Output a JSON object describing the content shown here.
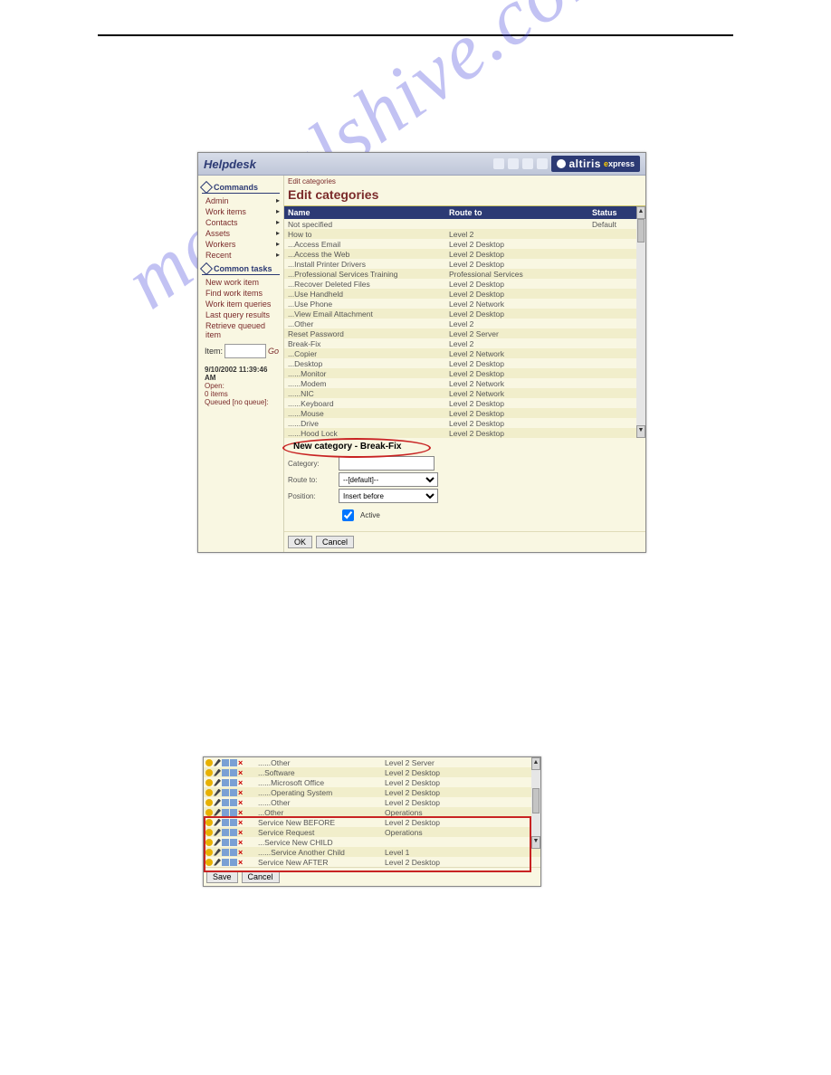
{
  "watermark": "manualshive.com",
  "screenshot1": {
    "app_title": "Helpdesk",
    "brand_altiris": "altiris",
    "brand_express_prefix": "e",
    "brand_express_rest": "xpress",
    "sidebar": {
      "commands_header": "Commands",
      "tasks_header": "Common tasks",
      "commands": [
        {
          "label": "Admin",
          "has_sub": true
        },
        {
          "label": "Work items",
          "has_sub": true
        },
        {
          "label": "Contacts",
          "has_sub": true
        },
        {
          "label": "Assets",
          "has_sub": true
        },
        {
          "label": "Workers",
          "has_sub": true
        },
        {
          "label": "Recent",
          "has_sub": true
        }
      ],
      "tasks": [
        {
          "label": "New work item"
        },
        {
          "label": "Find work items"
        },
        {
          "label": "Work item queries"
        },
        {
          "label": "Last query results"
        },
        {
          "label": "Retrieve queued item"
        }
      ],
      "item_label": "Item:",
      "go_label": "Go",
      "timestamp": "9/10/2002 11:39:46 AM",
      "status_open": "Open:",
      "status_items": "0 items",
      "status_queued": "Queued [no queue]:"
    },
    "breadcrumb": "Edit categories",
    "heading": "Edit categories",
    "columns": {
      "name": "Name",
      "route": "Route to",
      "status": "Status"
    },
    "rows": [
      {
        "name": "Not specified",
        "route": "",
        "status": "Default"
      },
      {
        "name": "How to",
        "route": "Level 2",
        "status": ""
      },
      {
        "name": "...Access Email",
        "route": "Level 2 Desktop",
        "status": ""
      },
      {
        "name": "...Access the Web",
        "route": "Level 2 Desktop",
        "status": ""
      },
      {
        "name": "...Install Printer Drivers",
        "route": "Level 2 Desktop",
        "status": ""
      },
      {
        "name": "...Professional Services Training",
        "route": "Professional Services",
        "status": ""
      },
      {
        "name": "...Recover Deleted Files",
        "route": "Level 2 Desktop",
        "status": ""
      },
      {
        "name": "...Use Handheld",
        "route": "Level 2 Desktop",
        "status": ""
      },
      {
        "name": "...Use Phone",
        "route": "Level 2 Network",
        "status": ""
      },
      {
        "name": "...View Email Attachment",
        "route": "Level 2 Desktop",
        "status": ""
      },
      {
        "name": "...Other",
        "route": "Level 2",
        "status": ""
      },
      {
        "name": "Reset Password",
        "route": "Level 2 Server",
        "status": ""
      },
      {
        "name": "Break-Fix",
        "route": "Level 2",
        "status": ""
      },
      {
        "name": "...Copier",
        "route": "Level 2 Network",
        "status": ""
      },
      {
        "name": "...Desktop",
        "route": "Level 2 Desktop",
        "status": ""
      },
      {
        "name": "......Monitor",
        "route": "Level 2 Desktop",
        "status": ""
      },
      {
        "name": "......Modem",
        "route": "Level 2 Network",
        "status": ""
      },
      {
        "name": "......NIC",
        "route": "Level 2 Network",
        "status": ""
      },
      {
        "name": "......Keyboard",
        "route": "Level 2 Desktop",
        "status": ""
      },
      {
        "name": "......Mouse",
        "route": "Level 2 Desktop",
        "status": ""
      },
      {
        "name": "......Drive",
        "route": "Level 2 Desktop",
        "status": ""
      },
      {
        "name": "......Hood Lock",
        "route": "Level 2 Desktop",
        "status": ""
      }
    ],
    "form": {
      "title": "New category - Break-Fix",
      "category_label": "Category:",
      "route_label": "Route to:",
      "route_value": "--[default]--",
      "position_label": "Position:",
      "position_value": "Insert before",
      "active_label": "Active",
      "ok": "OK",
      "cancel": "Cancel"
    }
  },
  "screenshot2": {
    "rows": [
      {
        "name": "......Other",
        "route": "Level 2 Server"
      },
      {
        "name": "...Software",
        "route": "Level 2 Desktop"
      },
      {
        "name": "......Microsoft Office",
        "route": "Level 2 Desktop"
      },
      {
        "name": "......Operating System",
        "route": "Level 2 Desktop"
      },
      {
        "name": "......Other",
        "route": "Level 2 Desktop"
      },
      {
        "name": "...Other",
        "route": "Operations"
      },
      {
        "name": "Service New BEFORE",
        "route": "Level 2 Desktop"
      },
      {
        "name": "Service Request",
        "route": "Operations"
      },
      {
        "name": "...Service New CHILD",
        "route": ""
      },
      {
        "name": "......Service Another Child",
        "route": "Level 1"
      },
      {
        "name": "Service New AFTER",
        "route": "Level 2 Desktop"
      }
    ],
    "save": "Save",
    "cancel": "Cancel"
  }
}
